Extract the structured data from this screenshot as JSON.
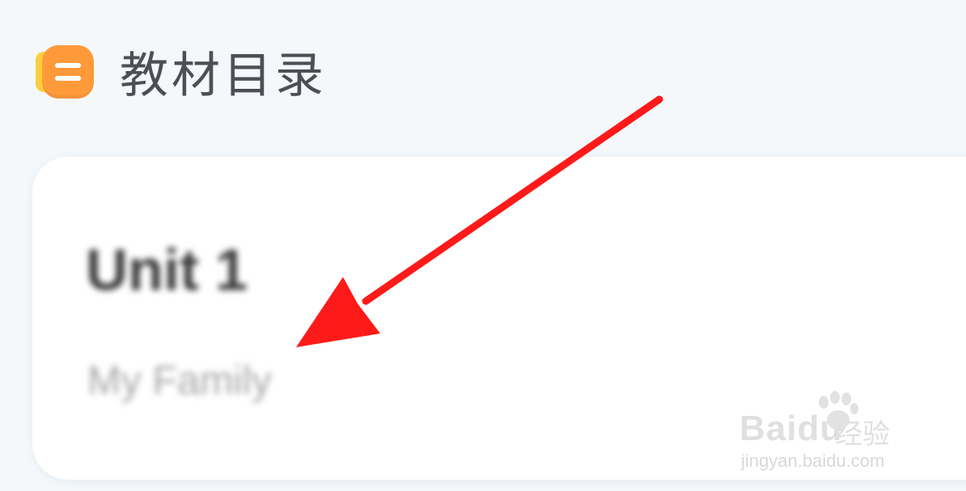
{
  "header": {
    "title": "教材目录",
    "icon": "book-icon"
  },
  "card": {
    "unit_title": "Unit 1",
    "unit_subtitle": "My Family"
  },
  "annotation": {
    "arrow_color": "#ff1a1a"
  },
  "watermark": {
    "brand": "Baidu",
    "brand_suffix": "经验",
    "url": "jingyan.baidu.com"
  },
  "colors": {
    "background": "#f4f8fb",
    "icon_orange": "#ff9a3a",
    "icon_yellow": "#ffcf3f",
    "title_text": "#4c4f55"
  }
}
